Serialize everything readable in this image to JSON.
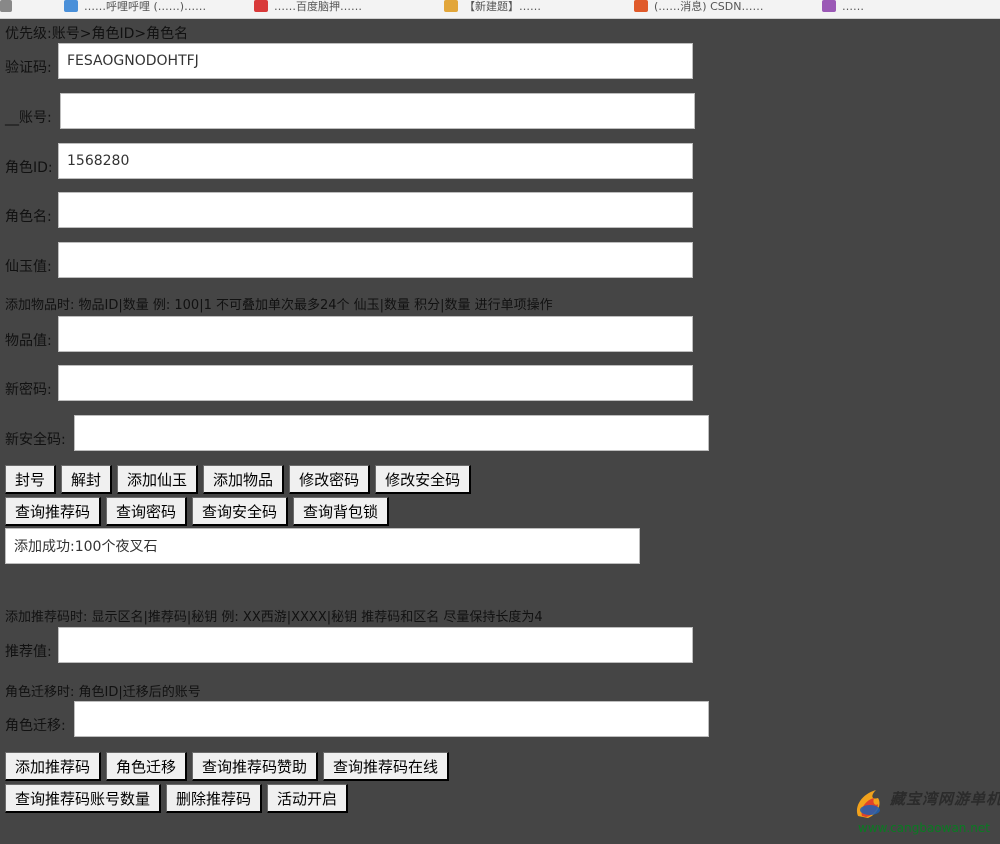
{
  "browser": {
    "bookmarks": [
      {
        "label": "……呼哩呼哩 (……)……",
        "icon": "bookmark-icon",
        "color": "#4a90d9"
      },
      {
        "label": "……百度脑押……",
        "icon": "bookmark-icon",
        "color": "#d93a3a"
      },
      {
        "label": "【新建题】……",
        "icon": "bookmark-icon",
        "color": "#e2a63a"
      },
      {
        "label": "(……消息) CSDN……",
        "icon": "bookmark-icon",
        "color": "#e05a2a"
      },
      {
        "label": "……",
        "icon": "bookmark-icon",
        "color": "#9b59b6"
      }
    ]
  },
  "form": {
    "priority": "优先级:账号>角色ID>角色名",
    "fields": {
      "code": {
        "label": "验证码:",
        "value": "FESAOGNODOHTFJ"
      },
      "account": {
        "label": "__账号:",
        "value": ""
      },
      "role_id": {
        "label": "角色ID:",
        "value": "1568280"
      },
      "role_name": {
        "label": "角色名:",
        "value": ""
      },
      "jade": {
        "label": "仙玉值:",
        "value": ""
      },
      "item": {
        "label": "物品值:",
        "value": ""
      },
      "new_password": {
        "label": "新密码:",
        "value": ""
      },
      "new_security": {
        "label": "新安全码:",
        "value": ""
      },
      "referral": {
        "label": "推荐值:",
        "value": ""
      },
      "migrate": {
        "label": "角色迁移:",
        "value": ""
      }
    },
    "hint_item": "添加物品时: 物品ID|数量 例: 100|1 不可叠加单次最多24个 仙玉|数量 积分|数量 进行单项操作",
    "hint_referral": "添加推荐码时: 显示区名|推荐码|秘钥 例: XX西游|XXXX|秘钥 推荐码和区名 尽量保持长度为4",
    "hint_migrate": "角色迁移时: 角色ID|迁移后的账号",
    "result": "添加成功:100个夜叉石"
  },
  "buttons": {
    "ban": "封号",
    "unban": "解封",
    "add_jade": "添加仙玉",
    "add_item": "添加物品",
    "change_password": "修改密码",
    "change_security": "修改安全码",
    "query_referral": "查询推荐码",
    "query_password": "查询密码",
    "query_security": "查询安全码",
    "query_bag_lock": "查询背包锁",
    "add_referral": "添加推荐码",
    "role_migrate": "角色迁移",
    "query_referral_sponsor": "查询推荐码赞助",
    "query_referral_online": "查询推荐码在线",
    "query_referral_accounts": "查询推荐码账号数量",
    "delete_referral": "删除推荐码",
    "activity_on": "活动开启"
  },
  "watermark": {
    "title": "藏宝湾网游单机",
    "url": "www.cangbaowan.net"
  }
}
